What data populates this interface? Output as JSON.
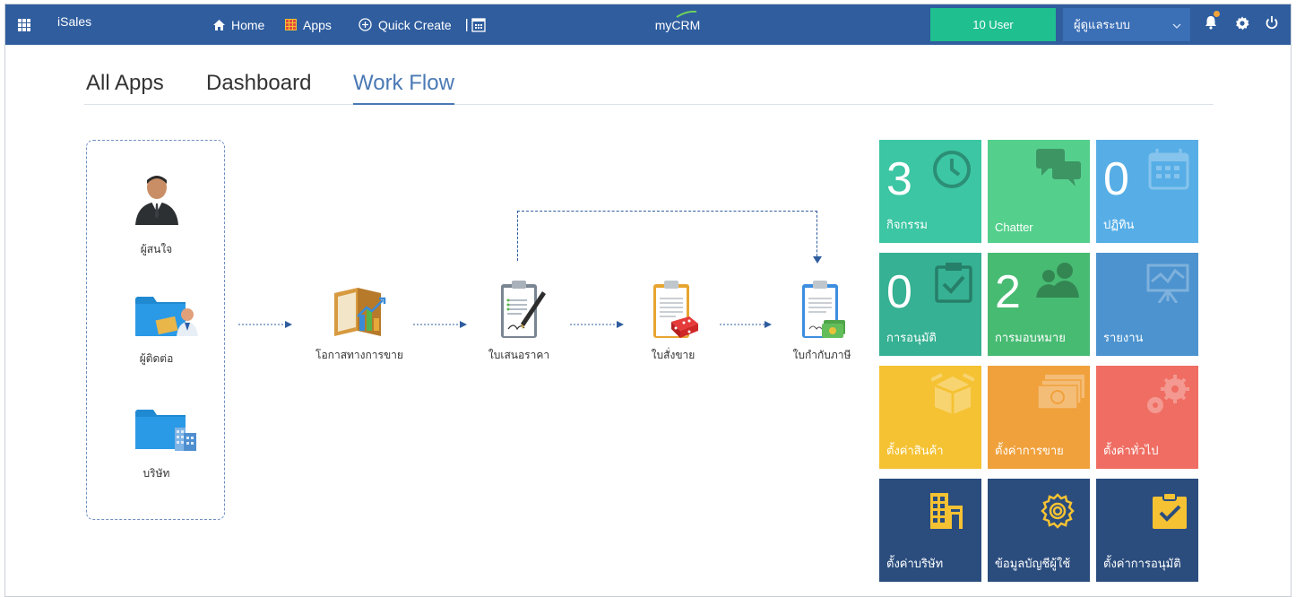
{
  "topbar": {
    "brand": "iSales",
    "nav": [
      {
        "label": "Home",
        "icon": "home-icon"
      },
      {
        "label": "Apps",
        "icon": "apps-icon"
      },
      {
        "label": "Quick Create",
        "icon": "plus-circle-icon"
      }
    ],
    "center_title": "myCRM",
    "user_count": "10 User",
    "role": "ผู้ดูแลระบบ"
  },
  "tabs": [
    {
      "label": "All Apps",
      "active": false
    },
    {
      "label": "Dashboard",
      "active": false
    },
    {
      "label": "Work Flow",
      "active": true
    }
  ],
  "entities": [
    {
      "label": "ผู้สนใจ",
      "icon": "person-icon"
    },
    {
      "label": "ผู้ติดต่อ",
      "icon": "contact-folder-icon"
    },
    {
      "label": "บริษัท",
      "icon": "company-folder-icon"
    }
  ],
  "flow": [
    {
      "label": "โอกาสทางการขาย",
      "icon": "opportunity-icon"
    },
    {
      "label": "ใบเสนอราคา",
      "icon": "quotation-icon"
    },
    {
      "label": "ใบสั่งขาย",
      "icon": "sales-order-icon"
    },
    {
      "label": "ใบกำกับภาษี",
      "icon": "invoice-icon"
    }
  ],
  "tiles": [
    {
      "number": "3",
      "label": "กิจกรรม",
      "color": "#3cc6a3",
      "icon": "clock-icon"
    },
    {
      "number": "",
      "label": "Chatter",
      "color": "#55d08c",
      "icon": "chat-icon"
    },
    {
      "number": "0",
      "label": "ปฏิทิน",
      "color": "#57aee6",
      "icon": "calendar-icon"
    },
    {
      "number": "0",
      "label": "การอนุมัติ",
      "color": "#36b193",
      "icon": "checklist-icon"
    },
    {
      "number": "2",
      "label": "การมอบหมาย",
      "color": "#48bb73",
      "icon": "users-icon"
    },
    {
      "number": "",
      "label": "รายงาน",
      "color": "#4c93cf",
      "icon": "chart-board-icon"
    },
    {
      "number": "",
      "label": "ตั้งค่าสินค้า",
      "color": "#f5c233",
      "icon": "box-icon"
    },
    {
      "number": "",
      "label": "ตั้งค่าการขาย",
      "color": "#f0a13c",
      "icon": "money-icon"
    },
    {
      "number": "",
      "label": "ตั้งค่าทั่วไป",
      "color": "#ef6d62",
      "icon": "gears-icon"
    },
    {
      "number": "",
      "label": "ตั้งค่าบริษัท",
      "color": "#2b4d7e",
      "icon": "building-icon"
    },
    {
      "number": "",
      "label": "ข้อมูลบัญชีผู้ใช้",
      "color": "#2b4d7e",
      "icon": "gear-icon"
    },
    {
      "number": "",
      "label": "ตั้งค่าการอนุมัติ",
      "color": "#2b4d7e",
      "icon": "clipboard-check-icon"
    }
  ]
}
